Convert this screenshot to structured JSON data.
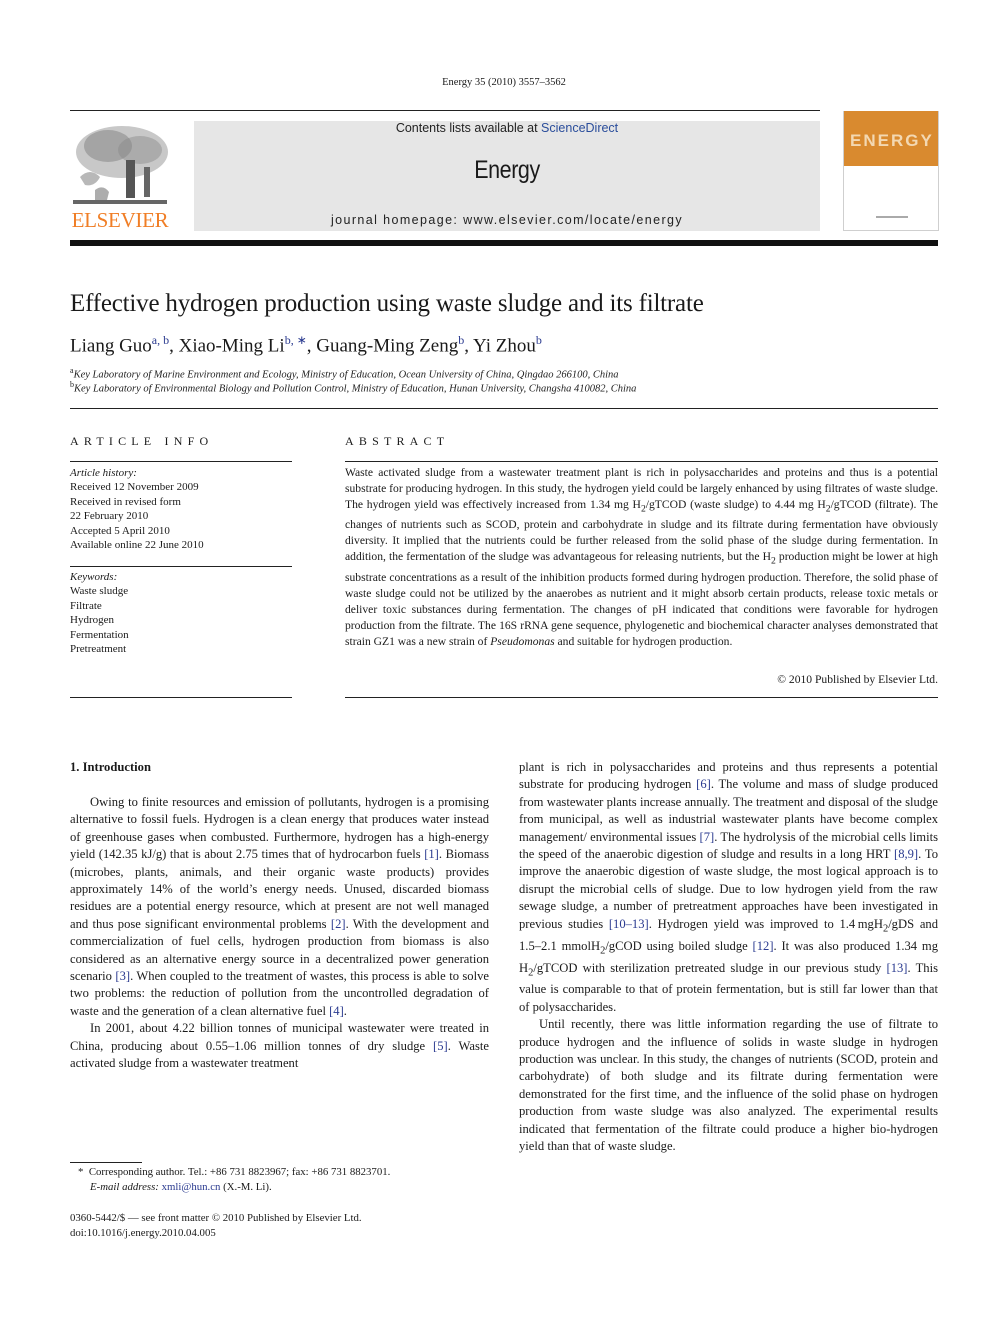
{
  "journal_citation": "Energy 35 (2010) 3557–3562",
  "header": {
    "publisher_logo_text": "ELSEVIER",
    "contents_prefix": "Contents lists available at ",
    "contents_link": "ScienceDirect",
    "journal_name": "Energy",
    "homepage": "journal homepage: www.elsevier.com/locate/energy",
    "cover_title": "ENERGY",
    "brand_color": "#f07e26",
    "cover_color": "#d98a2f"
  },
  "article": {
    "title": "Effective hydrogen production using waste sludge and its filtrate",
    "authors": [
      {
        "name": "Liang Guo",
        "sup": "a, b"
      },
      {
        "name": "Xiao-Ming Li",
        "sup": "b, ∗"
      },
      {
        "name": "Guang-Ming Zeng",
        "sup": "b"
      },
      {
        "name": "Yi Zhou",
        "sup": "b"
      }
    ],
    "affiliations": [
      {
        "mark": "a",
        "text": "Key Laboratory of Marine Environment and Ecology, Ministry of Education, Ocean University of China, Qingdao 266100, China"
      },
      {
        "mark": "b",
        "text": "Key Laboratory of Environmental Biology and Pollution Control, Ministry of Education, Hunan University, Changsha 410082, China"
      }
    ]
  },
  "article_info": {
    "heading": "ARTICLE INFO",
    "history_label": "Article history:",
    "history": [
      "Received 12 November 2009",
      "Received in revised form",
      "22 February 2010",
      "Accepted 5 April 2010",
      "Available online 22 June 2010"
    ],
    "keywords_label": "Keywords:",
    "keywords": [
      "Waste sludge",
      "Filtrate",
      "Hydrogen",
      "Fermentation",
      "Pretreatment"
    ]
  },
  "abstract": {
    "heading": "ABSTRACT",
    "parts": {
      "p1": "Waste activated sludge from a wastewater treatment plant is rich in polysaccharides and proteins and thus is a potential substrate for producing hydrogen. In this study, the hydrogen yield could be largely enhanced by using filtrates of waste sludge. The hydrogen yield was effectively increased from 1.34 mg H",
      "p2": "/gTCOD (waste sludge) to 4.44 mg H",
      "p3": "/gTCOD (filtrate). The changes of nutrients such as SCOD, protein and carbohydrate in sludge and its filtrate during fermentation have obviously diversity. It implied that the nutrients could be further released from the solid phase of the sludge during fermentation. In addition, the fermentation of the sludge was advantageous for releasing nutrients, but the H",
      "p4": " production might be lower at high substrate concentrations as a result of the inhibition products formed during hydrogen production. Therefore, the solid phase of waste sludge could not be utilized by the anaerobes as nutrient and it might absorb certain products, release toxic metals or deliver toxic substances during fermentation. The changes of pH indicated that conditions were favorable for hydrogen production from the filtrate. The 16S rRNA gene sequence, phylogenetic and biochemical character analyses demonstrated that strain GZ1 was a new strain of ",
      "genus": "Pseudomonas",
      "p5": " and suitable for hydrogen production.",
      "sub2": "2"
    },
    "copyright": "© 2010 Published by Elsevier Ltd."
  },
  "introduction": {
    "heading": "1.  Introduction",
    "para1": {
      "a": "Owing to finite resources and emission of pollutants, hydrogen is a promising alternative to fossil fuels. Hydrogen is a clean energy that produces water instead of greenhouse gases when combusted. Furthermore, hydrogen has a high-energy yield (142.35 kJ/g) that is about 2.75 times that of hydrocarbon fuels ",
      "r1": "[1]",
      "b": ". Biomass (microbes, plants, animals, and their organic waste products) provides approximately 14% of the world’s energy needs. Unused, discarded biomass residues are a potential energy resource, which at present are not well managed and thus pose significant environmental problems ",
      "r2": "[2]",
      "c": ". With the development and commercialization of fuel cells, hydrogen production from biomass is also considered as an alternative energy source in a decentralized power generation scenario ",
      "r3": "[3]",
      "d": ". When coupled to the treatment of wastes, this process is able to solve two problems: the reduction of pollution from the uncontrolled degradation of waste and the generation of a clean alternative fuel ",
      "r4": "[4]",
      "e": "."
    },
    "para2": {
      "a": "In 2001, about 4.22 billion tonnes of municipal wastewater were treated in China, producing about 0.55–1.06 million tonnes of dry sludge ",
      "r5": "[5]",
      "b": ". Waste activated sludge from a wastewater treatment plant is rich in polysaccharides and proteins and thus represents a potential substrate for producing hydrogen ",
      "r6": "[6]",
      "c": ". The volume and mass of sludge produced from wastewater plants increase annually. The treatment and disposal of the sludge from municipal, as well as industrial wastewater plants have become complex management/ environmental issues ",
      "r7": "[7]",
      "d": ". The hydrolysis of the microbial cells limits the speed of the anaerobic digestion of sludge and results in a long HRT ",
      "r89": "[8,9]",
      "e": ". To improve the anaerobic digestion of waste sludge, the most logical approach is to disrupt the microbial cells of sludge. Due to low hydrogen yield from the raw sewage sludge, a number of pretreatment approaches have been investigated in previous studies ",
      "r1013": "[10–13]",
      "f": ". Hydrogen yield was improved to 1.4 mgH",
      "g": "/gDS and 1.5–2.1 mmolH",
      "h": "/gCOD using boiled sludge ",
      "r12": "[12]",
      "i": ". It was also produced 1.34 mg H",
      "j": "/gTCOD with sterilization pretreated sludge in our previous study ",
      "r13": "[13]",
      "k": ". This value is comparable to that of protein fermentation, but is still far lower than that of polysaccharides.",
      "sub2": "2"
    },
    "para3": "Until recently, there was little information regarding the use of filtrate to produce hydrogen and the influence of solids in waste sludge in hydrogen production was unclear. In this study, the changes of nutrients (SCOD, protein and carbohydrate) of both sludge and its filtrate during fermentation were demonstrated for the first time, and the influence of the solid phase on hydrogen production from waste sludge was also analyzed. The experimental results indicated that fermentation of the filtrate could produce a higher bio-hydrogen yield than that of waste sludge."
  },
  "footnote": {
    "mark": "*",
    "corresponding": "Corresponding author. Tel.: +86 731 8823967; fax: +86 731 8823701.",
    "email_label": "E-mail address:",
    "email": "xmli@hun.cn",
    "email_suffix": " (X.-M. Li)."
  },
  "front_matter": {
    "issn_line": "0360-5442/$ — see front matter © 2010 Published by Elsevier Ltd.",
    "doi": "doi:10.1016/j.energy.2010.04.005"
  }
}
